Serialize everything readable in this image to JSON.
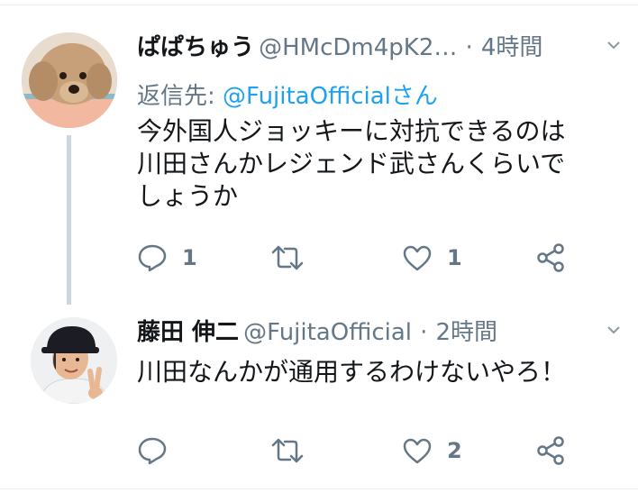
{
  "tweets": [
    {
      "name": "ぱぱちゅう",
      "handle": "@HMcDm4pK2…",
      "separator": "·",
      "time": "4時間",
      "reply_label": "返信先:",
      "reply_to": "@FujitaOfficialさん",
      "lines": [
        "今外国人ジョッキーに対抗できるのは",
        "川田さんかレジェンド武さんくらいで",
        "しょうか"
      ],
      "replies": "1",
      "retweets": "",
      "likes": "1"
    },
    {
      "name": "藤田 伸二",
      "handle": "@FujitaOfficial",
      "separator": "·",
      "time": "2時間",
      "lines": [
        "川田なんかが通用するわけないやろ！"
      ],
      "replies": "",
      "retweets": "",
      "likes": "2"
    }
  ],
  "icons": {
    "reply": "reply-icon",
    "retweet": "retweet-icon",
    "like": "heart-icon",
    "share": "share-icon",
    "caret": "chevron-down-icon"
  },
  "colors": {
    "text": "#14171a",
    "secondary": "#657786",
    "link": "#1da1f2",
    "thread_line": "#ccd6dd"
  }
}
